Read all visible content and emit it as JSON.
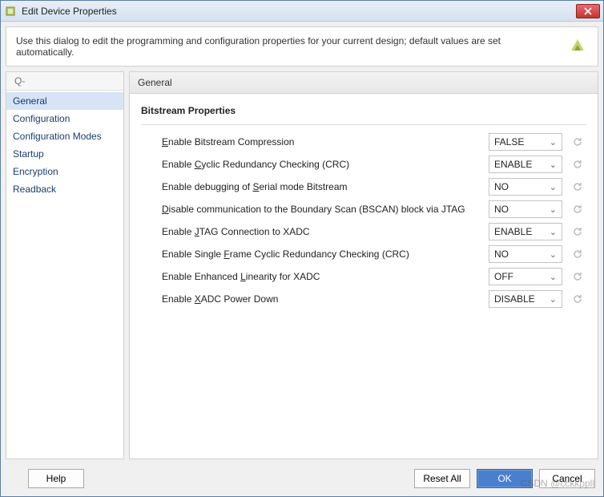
{
  "window": {
    "title": "Edit Device Properties"
  },
  "info": {
    "text": "Use this dialog to edit the programming and configuration properties for your current design; default values are set automatically."
  },
  "search": {
    "placeholder": "Q-"
  },
  "sidebar": {
    "items": [
      {
        "label": "General",
        "selected": true
      },
      {
        "label": "Configuration",
        "selected": false
      },
      {
        "label": "Configuration Modes",
        "selected": false
      },
      {
        "label": "Startup",
        "selected": false
      },
      {
        "label": "Encryption",
        "selected": false
      },
      {
        "label": "Readback",
        "selected": false
      }
    ]
  },
  "pane": {
    "header": "General",
    "section": "Bitstream Properties",
    "props": [
      {
        "label_html": "<u>E</u>nable Bitstream Compression",
        "value": "FALSE"
      },
      {
        "label_html": "Enable <u>C</u>yclic Redundancy Checking (CRC)",
        "value": "ENABLE"
      },
      {
        "label_html": "Enable debugging of <u>S</u>erial mode Bitstream",
        "value": "NO"
      },
      {
        "label_html": "<u>D</u>isable communication to the Boundary Scan (BSCAN) block via JTAG",
        "value": "NO"
      },
      {
        "label_html": "Enable <u>J</u>TAG Connection to XADC",
        "value": "ENABLE"
      },
      {
        "label_html": "Enable Single <u>F</u>rame Cyclic Redundancy Checking (CRC)",
        "value": "NO"
      },
      {
        "label_html": "Enable Enhanced <u>L</u>inearity for XADC",
        "value": "OFF"
      },
      {
        "label_html": "Enable <u>X</u>ADC Power Down",
        "value": "DISABLE"
      }
    ]
  },
  "footer": {
    "help": "Help",
    "reset_all": "Reset All",
    "ok": "OK",
    "cancel": "Cancel"
  },
  "watermark": "CSDN @cckkppll"
}
